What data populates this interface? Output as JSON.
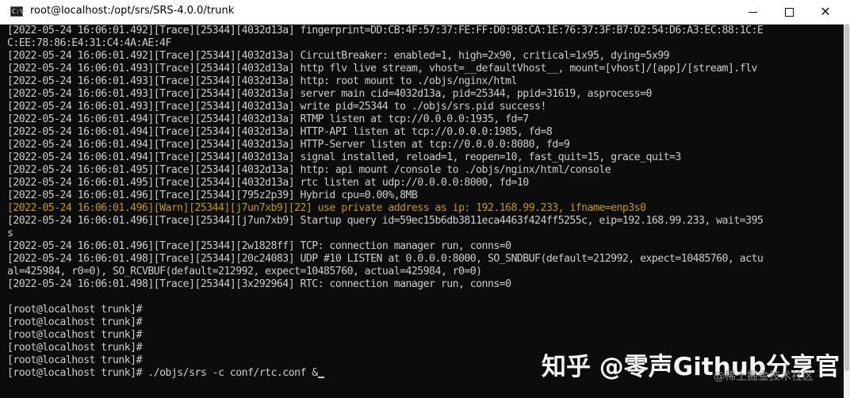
{
  "window": {
    "title": "root@localhost:/opt/srs/SRS-4.0.0/trunk",
    "icon": "terminal-icon",
    "icon_glyph": "C:\\",
    "minimize_glyph": "",
    "close_glyph": "✕"
  },
  "terminal": {
    "colors": {
      "background": "#0c0c0c",
      "text": "#cccccc",
      "warn": "#c19c00"
    },
    "lines": [
      {
        "text": "[2022-05-24 16:06:01.492][Trace][25344][4032d13a] fingerprint=DD:CB:4F:57:37:FE:FF:D0:9B:CA:1E:76:37:3F:B7:D2:54:D6:A3:EC:88:1C:E",
        "level": "trace"
      },
      {
        "text": "C:EE:78:86:E4:31:C4:4A:AE:4F",
        "level": "trace"
      },
      {
        "text": "[2022-05-24 16:06:01.492][Trace][25344][4032d13a] CircuitBreaker: enabled=1, high=2x90, critical=1x95, dying=5x99",
        "level": "trace"
      },
      {
        "text": "[2022-05-24 16:06:01.493][Trace][25344][4032d13a] http flv live stream, vhost=__defaultVhost__, mount=[vhost]/[app]/[stream].flv",
        "level": "trace"
      },
      {
        "text": "[2022-05-24 16:06:01.493][Trace][25344][4032d13a] http: root mount to ./objs/nginx/html",
        "level": "trace"
      },
      {
        "text": "[2022-05-24 16:06:01.493][Trace][25344][4032d13a] server main cid=4032d13a, pid=25344, ppid=31619, asprocess=0",
        "level": "trace"
      },
      {
        "text": "[2022-05-24 16:06:01.493][Trace][25344][4032d13a] write pid=25344 to ./objs/srs.pid success!",
        "level": "trace"
      },
      {
        "text": "[2022-05-24 16:06:01.494][Trace][25344][4032d13a] RTMP listen at tcp://0.0.0.0:1935, fd=7",
        "level": "trace"
      },
      {
        "text": "[2022-05-24 16:06:01.494][Trace][25344][4032d13a] HTTP-API listen at tcp://0.0.0.0:1985, fd=8",
        "level": "trace"
      },
      {
        "text": "[2022-05-24 16:06:01.494][Trace][25344][4032d13a] HTTP-Server listen at tcp://0.0.0.0:8080, fd=9",
        "level": "trace"
      },
      {
        "text": "[2022-05-24 16:06:01.494][Trace][25344][4032d13a] signal installed, reload=1, reopen=10, fast_quit=15, grace_quit=3",
        "level": "trace"
      },
      {
        "text": "[2022-05-24 16:06:01.495][Trace][25344][4032d13a] http: api mount /console to ./objs/nginx/html/console",
        "level": "trace"
      },
      {
        "text": "[2022-05-24 16:06:01.495][Trace][25344][4032d13a] rtc listen at udp://0.0.0.0:8000, fd=10",
        "level": "trace"
      },
      {
        "text": "[2022-05-24 16:06:01.496][Trace][25344][795z2p39] Hybrid cpu=0.00%,8MB",
        "level": "trace"
      },
      {
        "text": "[2022-05-24 16:06:01.496][Warn][25344][j7un7xb9][22] use private address as ip: 192.168.99.233, ifname=enp3s0",
        "level": "warn"
      },
      {
        "text": "[2022-05-24 16:06:01.496][Trace][25344][j7un7xb9] Startup query id=59ec15b6db3811eca4463f424ff5255c, eip=192.168.99.233, wait=395",
        "level": "trace"
      },
      {
        "text": "s",
        "level": "trace"
      },
      {
        "text": "[2022-05-24 16:06:01.496][Trace][25344][2w1828ff] TCP: connection manager run, conns=0",
        "level": "trace"
      },
      {
        "text": "[2022-05-24 16:06:01.498][Trace][25344][20c24083] UDP #10 LISTEN at 0.0.0.0:8000, SO_SNDBUF(default=212992, expect=10485760, actu",
        "level": "trace"
      },
      {
        "text": "al=425984, r0=0), SO_RCVBUF(default=212992, expect=10485760, actual=425984, r0=0)",
        "level": "trace"
      },
      {
        "text": "[2022-05-24 16:06:01.498][Trace][25344][3x292964] RTC: connection manager run, conns=0",
        "level": "trace"
      },
      {
        "text": "",
        "level": "trace"
      },
      {
        "text": "[root@localhost trunk]#",
        "level": "prompt"
      },
      {
        "text": "[root@localhost trunk]#",
        "level": "prompt"
      },
      {
        "text": "[root@localhost trunk]#",
        "level": "prompt"
      },
      {
        "text": "[root@localhost trunk]#",
        "level": "prompt"
      },
      {
        "text": "[root@localhost trunk]#",
        "level": "prompt"
      },
      {
        "text": "[root@localhost trunk]# ./objs/srs -c conf/rtc.conf &",
        "level": "prompt"
      }
    ]
  },
  "overlay": {
    "watermark": "知乎 @零声Github分享官",
    "watermark_small": "@稀土掘金技术社区"
  }
}
